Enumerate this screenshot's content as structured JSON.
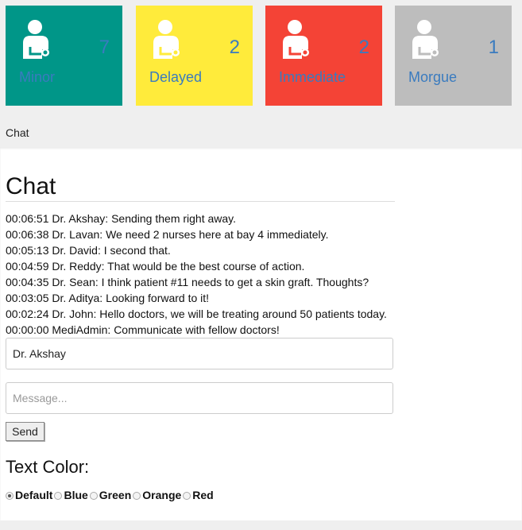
{
  "tiles": [
    {
      "label": "Minor",
      "count": "7",
      "color": "#009688",
      "icon": "patient-icon"
    },
    {
      "label": "Delayed",
      "count": "2",
      "color": "#ffeb3b",
      "icon": "patient-icon"
    },
    {
      "label": "Immediate",
      "count": "2",
      "color": "#f44336",
      "icon": "patient-icon"
    },
    {
      "label": "Morgue",
      "count": "1",
      "color": "#bdbdbd",
      "icon": "patient-icon"
    }
  ],
  "breadcrumb": "Chat",
  "chat": {
    "title": "Chat",
    "messages": [
      "00:06:51 Dr. Akshay: Sending them right away.",
      "00:06:38 Dr. Lavan: We need 2 nurses here at bay 4 immediately.",
      "00:05:13 Dr. David: I second that.",
      "00:04:59 Dr. Reddy: That would be the best course of action.",
      "00:04:35 Dr. Sean: I think patient #11 needs to get a skin graft. Thoughts?",
      "00:03:05 Dr. Aditya: Looking forward to it!",
      "00:02:24 Dr. John: Hello doctors, we will be treating around 50 patients today.",
      "00:00:00 MediAdmin: Communicate with fellow doctors!"
    ],
    "name_value": "Dr. Akshay",
    "message_placeholder": "Message...",
    "send_label": "Send"
  },
  "text_color": {
    "title": "Text Color:",
    "options": [
      "Default",
      "Blue",
      "Green",
      "Orange",
      "Red"
    ],
    "selected": "Default"
  }
}
